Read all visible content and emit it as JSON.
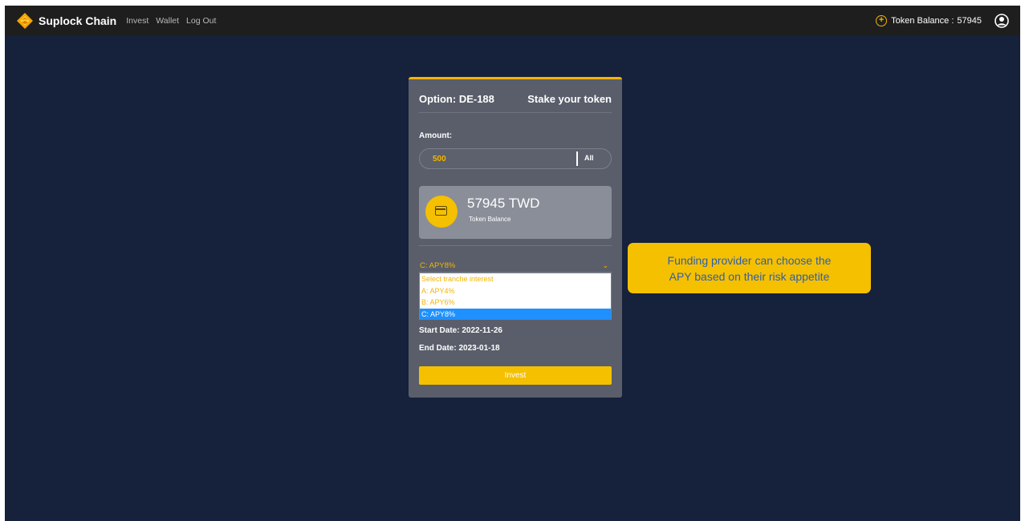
{
  "navbar": {
    "brand": "Suplock Chain",
    "links": [
      "Invest",
      "Wallet",
      "Log Out"
    ],
    "token_balance_label": "Token Balance :",
    "token_balance_value": "57945",
    "icons": {
      "logo": "suplock-logo-icon",
      "token": "plus-circle-icon",
      "profile": "user-circle-icon"
    }
  },
  "card": {
    "option_title": "Option: DE-188",
    "stake_title": "Stake your token",
    "amount_label": "Amount:",
    "amount_value": "500",
    "all_button": "All",
    "balance_amount": "57945 TWD",
    "balance_caption": "Token Balance",
    "select": {
      "selected_value": "C: APY8%",
      "options": [
        "Select tranche interest",
        "A: APY4%",
        "B: APY6%",
        "C: APY8%"
      ],
      "selected_index": 3
    },
    "start_date": "Start Date: 2022-11-26",
    "end_date": "End Date: 2023-01-18",
    "invest_button": "Invest"
  },
  "callout": {
    "line1": "Funding provider can choose the",
    "line2": "APY based on their risk appetite"
  },
  "colors": {
    "accent": "#f5b400",
    "background": "#16213b",
    "navbar": "#1e1e1e",
    "card": "#595e6a",
    "callout_text": "#2e5fae",
    "selected_option": "#1e90ff"
  }
}
